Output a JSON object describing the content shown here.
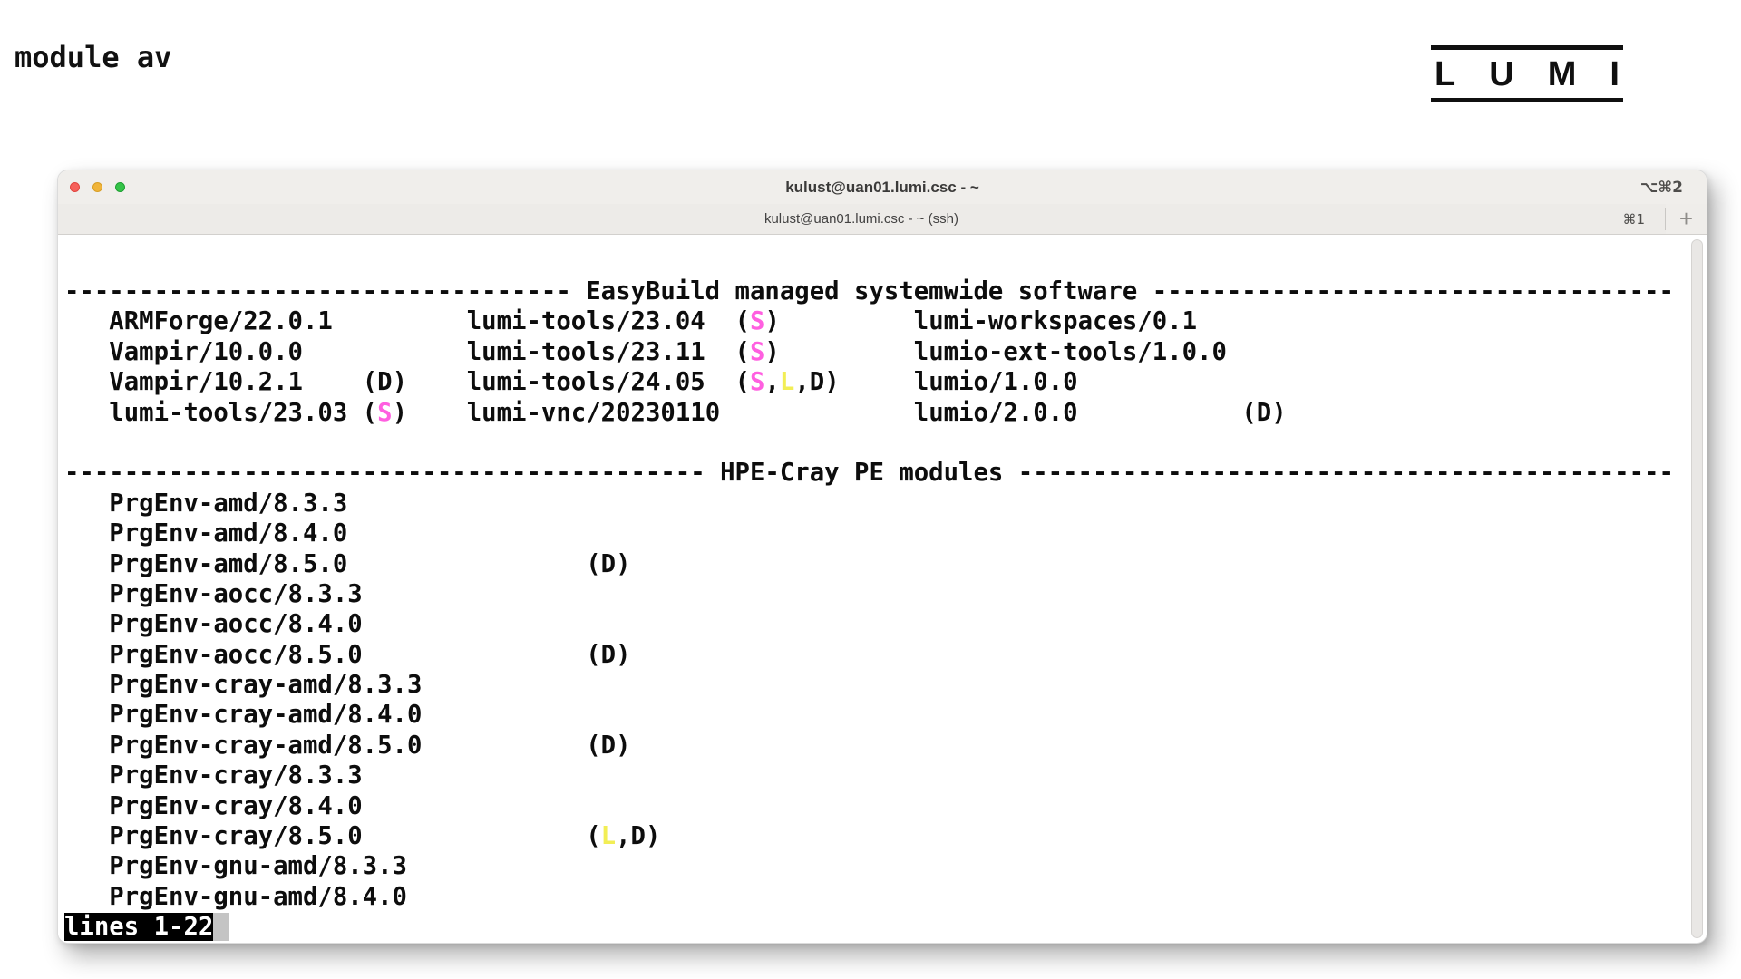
{
  "page": {
    "command_title": "module av"
  },
  "logo": {
    "letters": [
      "L",
      "U",
      "M",
      "I"
    ]
  },
  "window": {
    "title": "kulust@uan01.lumi.csc - ~",
    "title_shortcut": "⌥⌘2",
    "tab_title": "kulust@uan01.lumi.csc - ~ (ssh)",
    "tab_shortcut": "⌘1",
    "new_tab_label": "+",
    "traffic_lights": [
      "close",
      "minimize",
      "zoom"
    ]
  },
  "terminal": {
    "status_line": "lines 1-22",
    "colors": {
      "magenta": "#ff5fe0",
      "yellow": "#f2ee55",
      "text": "#0d0d0d"
    },
    "section_headers": [
      "EasyBuild managed systemwide software",
      "HPE-Cray PE modules"
    ],
    "lines": [
      [
        {
          "r": "-",
          "n": 34
        },
        {
          "t": " EasyBuild managed systemwide software "
        },
        {
          "r": "-",
          "n": 35
        }
      ],
      [
        {
          "t": "   ARMForge/22.0.1"
        },
        {
          "r": " ",
          "n": 9
        },
        {
          "t": "lumi-tools/23.04  ("
        },
        {
          "t": "S",
          "c": "magenta"
        },
        {
          "t": ")"
        },
        {
          "r": " ",
          "n": 9
        },
        {
          "t": "lumi-workspaces/0.1"
        }
      ],
      [
        {
          "t": "   Vampir/10.0.0"
        },
        {
          "r": " ",
          "n": 11
        },
        {
          "t": "lumi-tools/23.11  ("
        },
        {
          "t": "S",
          "c": "magenta"
        },
        {
          "t": ")"
        },
        {
          "r": " ",
          "n": 9
        },
        {
          "t": "lumio-ext-tools/1.0.0"
        }
      ],
      [
        {
          "t": "   Vampir/10.2.1"
        },
        {
          "r": " ",
          "n": 4
        },
        {
          "t": "(D)"
        },
        {
          "r": " ",
          "n": 4
        },
        {
          "t": "lumi-tools/24.05  ("
        },
        {
          "t": "S",
          "c": "magenta"
        },
        {
          "t": ","
        },
        {
          "t": "L",
          "c": "yellow"
        },
        {
          "t": ",D)"
        },
        {
          "r": " ",
          "n": 5
        },
        {
          "t": "lumio/1.0.0"
        }
      ],
      [
        {
          "t": "   lumi-tools/23.03 ("
        },
        {
          "t": "S",
          "c": "magenta"
        },
        {
          "t": ")"
        },
        {
          "r": " ",
          "n": 4
        },
        {
          "t": "lumi-vnc/20230110"
        },
        {
          "r": " ",
          "n": 13
        },
        {
          "t": "lumio/2.0.0"
        },
        {
          "r": " ",
          "n": 11
        },
        {
          "t": "(D)"
        }
      ],
      [],
      [
        {
          "r": "-",
          "n": 43
        },
        {
          "t": " HPE-Cray PE modules "
        },
        {
          "r": "-",
          "n": 44
        }
      ],
      [
        {
          "t": "   PrgEnv-amd/8.3.3"
        }
      ],
      [
        {
          "t": "   PrgEnv-amd/8.4.0"
        }
      ],
      [
        {
          "t": "   PrgEnv-amd/8.5.0"
        },
        {
          "r": " ",
          "n": 16
        },
        {
          "t": "(D)"
        }
      ],
      [
        {
          "t": "   PrgEnv-aocc/8.3.3"
        }
      ],
      [
        {
          "t": "   PrgEnv-aocc/8.4.0"
        }
      ],
      [
        {
          "t": "   PrgEnv-aocc/8.5.0"
        },
        {
          "r": " ",
          "n": 15
        },
        {
          "t": "(D)"
        }
      ],
      [
        {
          "t": "   PrgEnv-cray-amd/8.3.3"
        }
      ],
      [
        {
          "t": "   PrgEnv-cray-amd/8.4.0"
        }
      ],
      [
        {
          "t": "   PrgEnv-cray-amd/8.5.0"
        },
        {
          "r": " ",
          "n": 11
        },
        {
          "t": "(D)"
        }
      ],
      [
        {
          "t": "   PrgEnv-cray/8.3.3"
        }
      ],
      [
        {
          "t": "   PrgEnv-cray/8.4.0"
        }
      ],
      [
        {
          "t": "   PrgEnv-cray/8.5.0"
        },
        {
          "r": " ",
          "n": 15
        },
        {
          "t": "("
        },
        {
          "t": "L",
          "c": "yellow"
        },
        {
          "t": ",D)"
        }
      ],
      [
        {
          "t": "   PrgEnv-gnu-amd/8.3.3"
        }
      ],
      [
        {
          "t": "   PrgEnv-gnu-amd/8.4.0"
        }
      ],
      [
        {
          "t": "lines 1-22",
          "c": "inverse"
        },
        {
          "t": " ",
          "c": "cursor"
        }
      ]
    ]
  }
}
